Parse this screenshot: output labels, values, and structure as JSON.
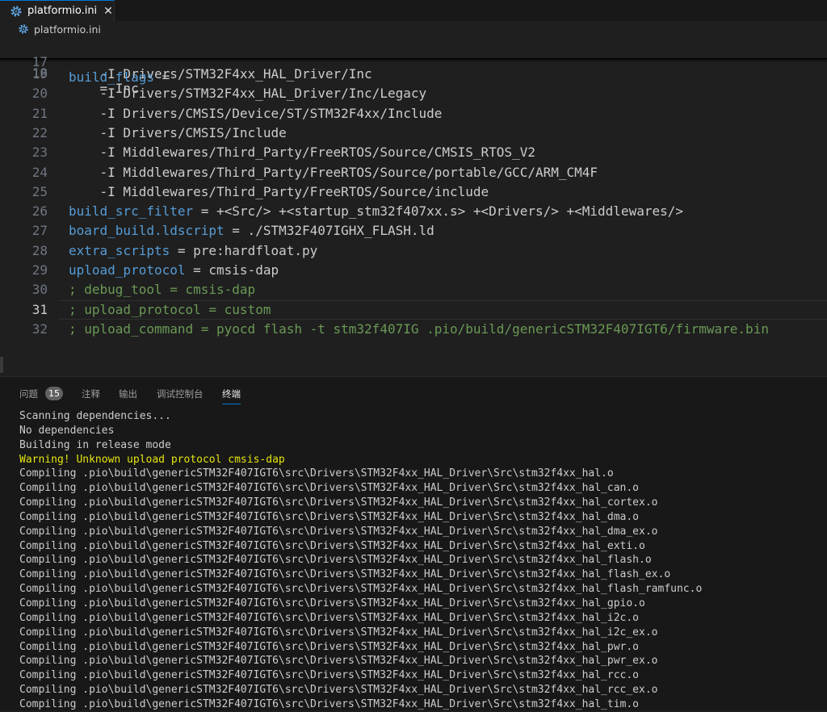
{
  "tab": {
    "label": "platformio.ini",
    "icon": "gear-icon",
    "close_icon": "close-icon",
    "close_glyph": "✕"
  },
  "breadcrumb": {
    "file": "platformio.ini",
    "icon": "gear-icon"
  },
  "colors": {
    "accent": "#0078d4",
    "keyword": "#569cd6",
    "comment": "#6a9955",
    "warning": "#e5e510",
    "text": "#cccccc"
  },
  "editor": {
    "sticky": {
      "num": "17",
      "key": "build_flags",
      "rest": " ="
    },
    "partial_line": {
      "num": "18",
      "text": "    = Inc"
    },
    "lines": [
      {
        "num": "19",
        "text": "    -I Drivers/STM32F4xx_HAL_Driver/Inc"
      },
      {
        "num": "20",
        "text": "    -I Drivers/STM32F4xx_HAL_Driver/Inc/Legacy"
      },
      {
        "num": "21",
        "text": "    -I Drivers/CMSIS/Device/ST/STM32F4xx/Include"
      },
      {
        "num": "22",
        "text": "    -I Drivers/CMSIS/Include"
      },
      {
        "num": "23",
        "text": "    -I Middlewares/Third_Party/FreeRTOS/Source/CMSIS_RTOS_V2"
      },
      {
        "num": "24",
        "text": "    -I Middlewares/Third_Party/FreeRTOS/Source/portable/GCC/ARM_CM4F"
      },
      {
        "num": "25",
        "text": "    -I Middlewares/Third_Party/FreeRTOS/Source/include"
      },
      {
        "num": "26",
        "key": "build_src_filter",
        "rest": " = +<Src/> +<startup_stm32f407xx.s> +<Drivers/> +<Middlewares/>"
      },
      {
        "num": "27",
        "key": "board_build.ldscript",
        "rest": " = ./STM32F407IGHX_FLASH.ld"
      },
      {
        "num": "28",
        "key": "extra_scripts",
        "rest": " = pre:hardfloat.py"
      },
      {
        "num": "29",
        "key": "upload_protocol",
        "rest": " = cmsis-dap"
      },
      {
        "num": "30",
        "comment": "; debug_tool = cmsis-dap"
      },
      {
        "num": "31",
        "comment": "; upload_protocol = custom"
      },
      {
        "num": "32",
        "comment": "; upload_command = pyocd flash -t stm32f407IG .pio/build/genericSTM32F407IGT6/firmware.bin"
      }
    ]
  },
  "panel": {
    "problems_label": "问题",
    "problems_count": "15",
    "comments_label": "注释",
    "output_label": "输出",
    "debug_console_label": "调试控制台",
    "terminal_label": "终端"
  },
  "terminal": {
    "lines": [
      {
        "text": "Scanning dependencies..."
      },
      {
        "text": "No dependencies"
      },
      {
        "text": "Building in release mode"
      },
      {
        "text": "Warning! Unknown upload protocol cmsis-dap",
        "warn": true
      },
      {
        "text": "Compiling .pio\\build\\genericSTM32F407IGT6\\src\\Drivers\\STM32F4xx_HAL_Driver\\Src\\stm32f4xx_hal.o"
      },
      {
        "text": "Compiling .pio\\build\\genericSTM32F407IGT6\\src\\Drivers\\STM32F4xx_HAL_Driver\\Src\\stm32f4xx_hal_can.o"
      },
      {
        "text": "Compiling .pio\\build\\genericSTM32F407IGT6\\src\\Drivers\\STM32F4xx_HAL_Driver\\Src\\stm32f4xx_hal_cortex.o"
      },
      {
        "text": "Compiling .pio\\build\\genericSTM32F407IGT6\\src\\Drivers\\STM32F4xx_HAL_Driver\\Src\\stm32f4xx_hal_dma.o"
      },
      {
        "text": "Compiling .pio\\build\\genericSTM32F407IGT6\\src\\Drivers\\STM32F4xx_HAL_Driver\\Src\\stm32f4xx_hal_dma_ex.o"
      },
      {
        "text": "Compiling .pio\\build\\genericSTM32F407IGT6\\src\\Drivers\\STM32F4xx_HAL_Driver\\Src\\stm32f4xx_hal_exti.o"
      },
      {
        "text": "Compiling .pio\\build\\genericSTM32F407IGT6\\src\\Drivers\\STM32F4xx_HAL_Driver\\Src\\stm32f4xx_hal_flash.o"
      },
      {
        "text": "Compiling .pio\\build\\genericSTM32F407IGT6\\src\\Drivers\\STM32F4xx_HAL_Driver\\Src\\stm32f4xx_hal_flash_ex.o"
      },
      {
        "text": "Compiling .pio\\build\\genericSTM32F407IGT6\\src\\Drivers\\STM32F4xx_HAL_Driver\\Src\\stm32f4xx_hal_flash_ramfunc.o"
      },
      {
        "text": "Compiling .pio\\build\\genericSTM32F407IGT6\\src\\Drivers\\STM32F4xx_HAL_Driver\\Src\\stm32f4xx_hal_gpio.o"
      },
      {
        "text": "Compiling .pio\\build\\genericSTM32F407IGT6\\src\\Drivers\\STM32F4xx_HAL_Driver\\Src\\stm32f4xx_hal_i2c.o"
      },
      {
        "text": "Compiling .pio\\build\\genericSTM32F407IGT6\\src\\Drivers\\STM32F4xx_HAL_Driver\\Src\\stm32f4xx_hal_i2c_ex.o"
      },
      {
        "text": "Compiling .pio\\build\\genericSTM32F407IGT6\\src\\Drivers\\STM32F4xx_HAL_Driver\\Src\\stm32f4xx_hal_pwr.o"
      },
      {
        "text": "Compiling .pio\\build\\genericSTM32F407IGT6\\src\\Drivers\\STM32F4xx_HAL_Driver\\Src\\stm32f4xx_hal_pwr_ex.o"
      },
      {
        "text": "Compiling .pio\\build\\genericSTM32F407IGT6\\src\\Drivers\\STM32F4xx_HAL_Driver\\Src\\stm32f4xx_hal_rcc.o"
      },
      {
        "text": "Compiling .pio\\build\\genericSTM32F407IGT6\\src\\Drivers\\STM32F4xx_HAL_Driver\\Src\\stm32f4xx_hal_rcc_ex.o"
      },
      {
        "text": "Compiling .pio\\build\\genericSTM32F407IGT6\\src\\Drivers\\STM32F4xx_HAL_Driver\\Src\\stm32f4xx_hal_tim.o"
      }
    ]
  }
}
